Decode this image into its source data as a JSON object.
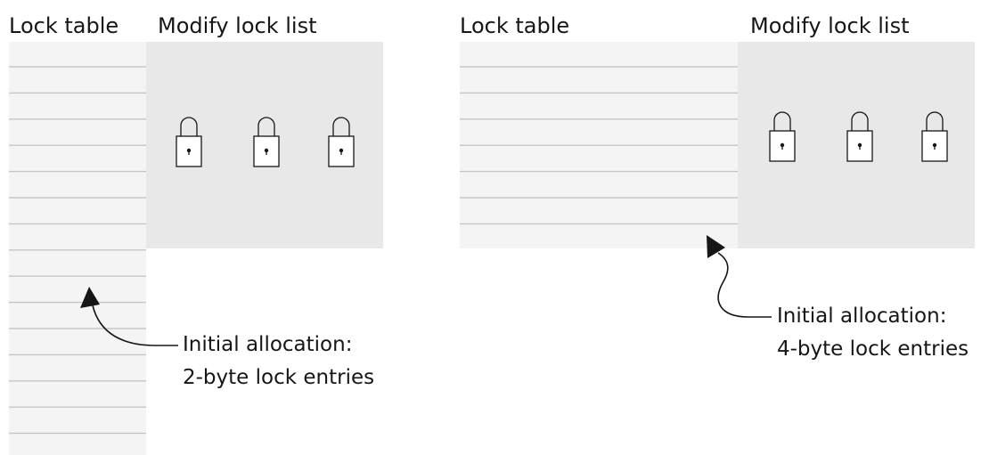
{
  "panels": [
    {
      "lock_table_label": "Lock table",
      "modify_lock_list_label": "Modify lock list",
      "lock_count": 3,
      "annotation": {
        "line1": "Initial allocation:",
        "line2": "2-byte lock entries"
      }
    },
    {
      "lock_table_label": "Lock table",
      "modify_lock_list_label": "Modify lock list",
      "lock_count": 3,
      "annotation": {
        "line1": "Initial allocation:",
        "line2": "4-byte lock entries"
      }
    }
  ],
  "colors": {
    "lock_table_fill": "#f4f4f4",
    "row_divider": "#c6c6c6",
    "lock_list_fill": "#e8e8e8",
    "ink": "#161616"
  }
}
